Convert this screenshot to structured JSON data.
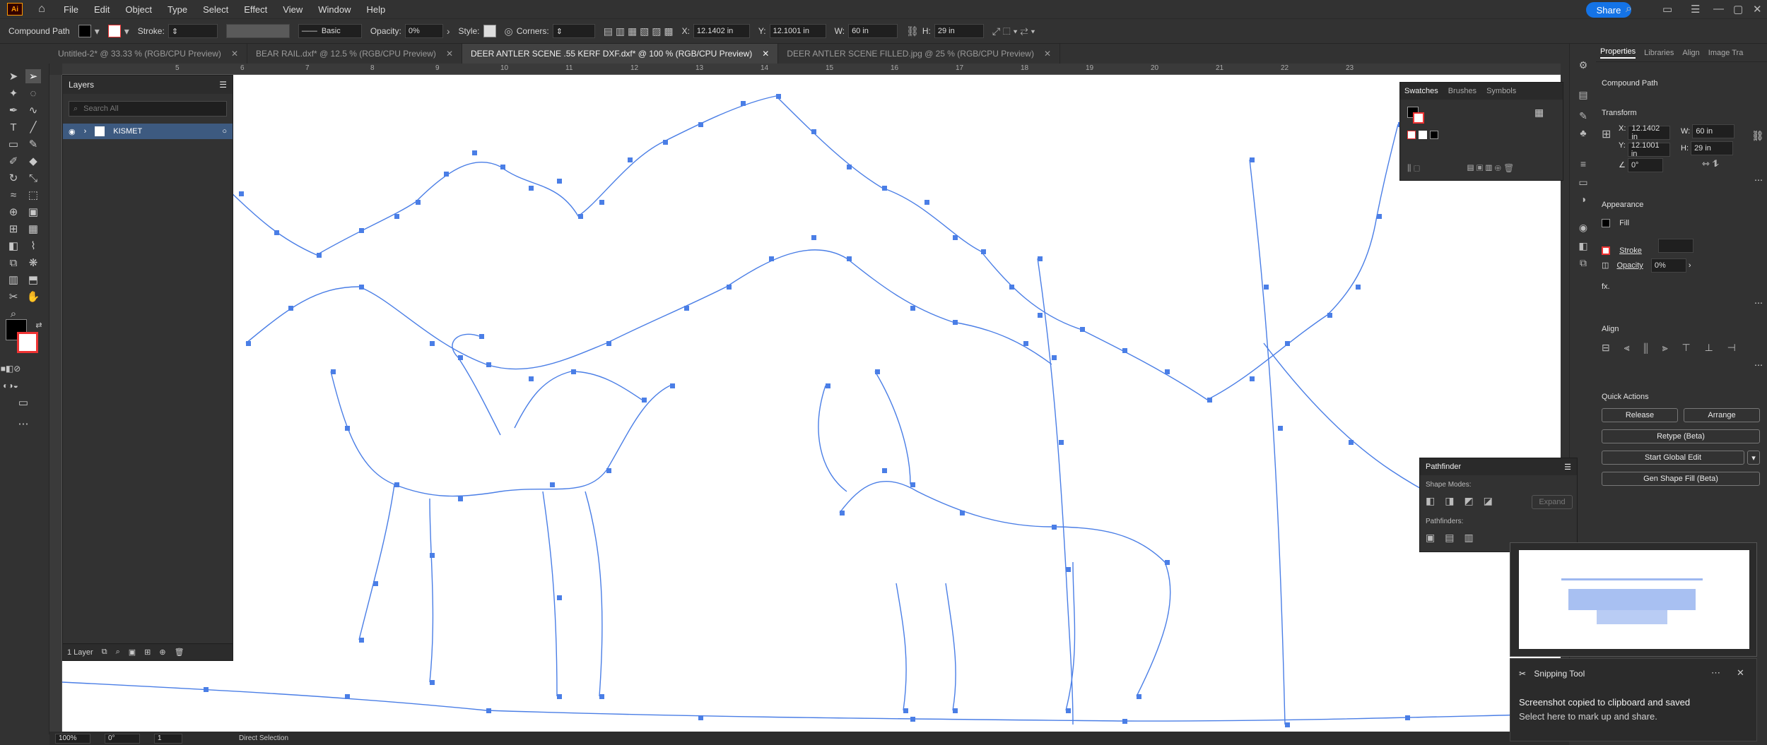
{
  "app": {
    "logo": "Ai",
    "share_label": "Share"
  },
  "menu": [
    "File",
    "Edit",
    "Object",
    "Type",
    "Select",
    "Effect",
    "View",
    "Window",
    "Help"
  ],
  "control_bar": {
    "selection_type": "Compound Path",
    "stroke_label": "Stroke:",
    "brush_label": "Basic",
    "opacity_label": "Opacity:",
    "opacity_value": "0%",
    "style_label": "Style:",
    "corners_label": "Corners:",
    "x_label": "X:",
    "x_value": "12.1402 in",
    "y_label": "Y:",
    "y_value": "12.1001 in",
    "w_label": "W:",
    "w_value": "60 in",
    "h_label": "H:",
    "h_value": "29 in"
  },
  "tabs": [
    {
      "label": "Untitled-2* @ 33.33 % (RGB/CPU Preview)",
      "active": false
    },
    {
      "label": "BEAR RAIL.dxf* @ 12.5 % (RGB/CPU Preview)",
      "active": false
    },
    {
      "label": "DEER ANTLER SCENE .55 KERF DXF.dxf* @ 100 % (RGB/CPU Preview)",
      "active": true
    },
    {
      "label": "DEER ANTLER SCENE FILLED.jpg @ 25 % (RGB/CPU Preview)",
      "active": false
    }
  ],
  "ruler": [
    "5",
    "6",
    "7",
    "8",
    "9",
    "10",
    "11",
    "12",
    "13",
    "14",
    "15",
    "16",
    "17",
    "18",
    "19",
    "20",
    "21",
    "22",
    "23"
  ],
  "layers_panel": {
    "title": "Layers",
    "search_placeholder": "Search All",
    "layer_name": "KISMET",
    "footer_count": "1 Layer"
  },
  "swatches_panel": {
    "tabs": [
      "Swatches",
      "Brushes",
      "Symbols"
    ]
  },
  "properties_panel": {
    "tabs": [
      "Properties",
      "Libraries",
      "Align",
      "Image Tra"
    ],
    "selection": "Compound Path",
    "transform_title": "Transform",
    "x_label": "X:",
    "x_value": "12.1402 in",
    "y_label": "Y:",
    "y_value": "12.1001 in",
    "w_label": "W:",
    "w_value": "60 in",
    "h_label": "H:",
    "h_value": "29 in",
    "angle_value": "0°",
    "appearance_title": "Appearance",
    "fill_label": "Fill",
    "stroke_label": "Stroke",
    "opacity_label": "Opacity",
    "opacity_value": "0%",
    "fx_label": "fx.",
    "align_title": "Align",
    "quick_actions_title": "Quick Actions",
    "release_label": "Release",
    "arrange_label": "Arrange",
    "retype_label": "Retype (Beta)",
    "global_edit_label": "Start Global Edit",
    "gen_fill_label": "Gen Shape Fill (Beta)"
  },
  "pathfinder_panel": {
    "title": "Pathfinder",
    "shape_modes": "Shape Modes:",
    "expand": "Expand",
    "pathfinders": "Pathfinders:"
  },
  "status_bar": {
    "zoom": "100%",
    "rotation": "0°",
    "artboard": "1",
    "tool": "Direct Selection"
  },
  "toast": {
    "app": "Snipping Tool",
    "title": "Screenshot copied to clipboard and saved",
    "body": "Select here to mark up and share."
  },
  "colors": {
    "accent": "#1473e6",
    "anchor_blue": "#4a7ee6",
    "layer_row": "#3d5a80"
  }
}
